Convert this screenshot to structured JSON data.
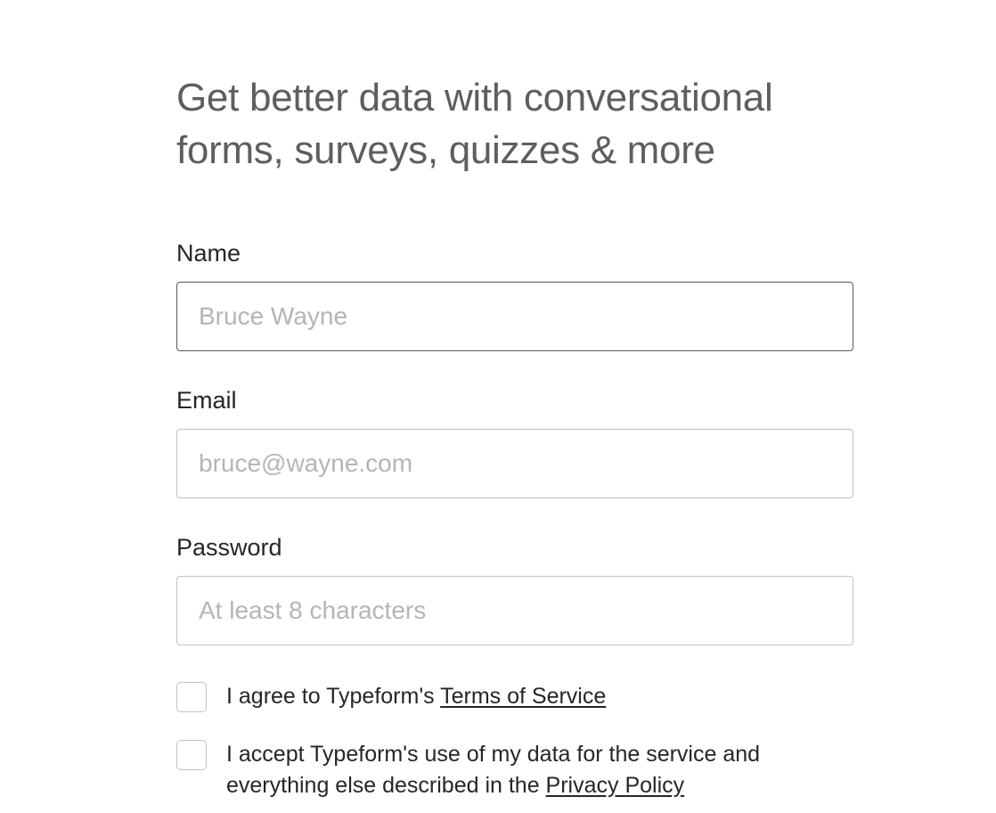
{
  "heading": "Get better data with conversational forms, surveys, quizzes & more",
  "fields": {
    "name": {
      "label": "Name",
      "placeholder": "Bruce Wayne",
      "value": ""
    },
    "email": {
      "label": "Email",
      "placeholder": "bruce@wayne.com",
      "value": ""
    },
    "password": {
      "label": "Password",
      "placeholder": "At least 8 characters",
      "value": ""
    }
  },
  "consents": {
    "terms": {
      "text_prefix": "I agree to Typeform's ",
      "link_text": "Terms of Service"
    },
    "privacy": {
      "text_prefix": "I accept Typeform's use of my data for the service and everything else described in the ",
      "link_text": "Privacy Policy"
    }
  }
}
